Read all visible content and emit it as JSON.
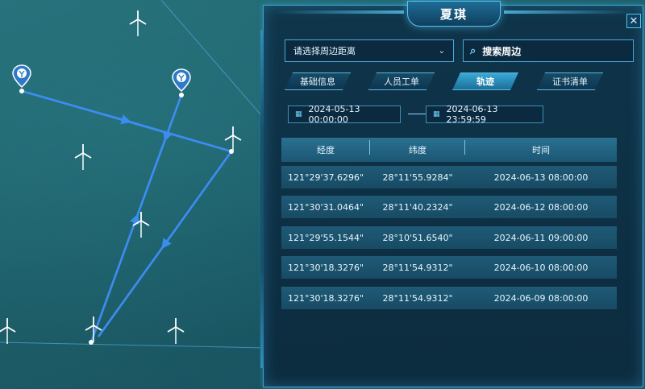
{
  "panel": {
    "title": "夏琪",
    "close_label": "✕"
  },
  "filter": {
    "distance_placeholder": "请选择周边距离",
    "search_label": "搜索周边"
  },
  "tabs": [
    {
      "label": "基础信息",
      "active": false
    },
    {
      "label": "人员工单",
      "active": false
    },
    {
      "label": "轨迹",
      "active": true
    },
    {
      "label": "证书清单",
      "active": false
    }
  ],
  "date_range": {
    "start": "2024-05-13 00:00:00",
    "end": "2024-06-13 23:59:59"
  },
  "table": {
    "columns": [
      "经度",
      "纬度",
      "时间"
    ],
    "rows": [
      {
        "lng": "121°29'37.6296\"",
        "lat": "28°11'55.9284\"",
        "time": "2024-06-13 08:00:00"
      },
      {
        "lng": "121°30'31.0464\"",
        "lat": "28°11'40.2324\"",
        "time": "2024-06-12 08:00:00"
      },
      {
        "lng": "121°29'55.1544\"",
        "lat": "28°10'51.6540\"",
        "time": "2024-06-11 09:00:00"
      },
      {
        "lng": "121°30'18.3276\"",
        "lat": "28°11'54.9312\"",
        "time": "2024-06-10 08:00:00"
      },
      {
        "lng": "121°30'18.3276\"",
        "lat": "28°11'54.9312\"",
        "time": "2024-06-09 08:00:00"
      }
    ]
  },
  "colors": {
    "track": "#3d8cf0",
    "accent": "#4aa9d6",
    "active_tab": "#3aa9d8"
  },
  "icons": {
    "map_marker": "location-pin-icon",
    "turbine": "wind-turbine-icon",
    "calendar": "calendar-icon",
    "search": "search-icon",
    "close": "close-icon",
    "dropdown": "chevron-down-icon"
  }
}
